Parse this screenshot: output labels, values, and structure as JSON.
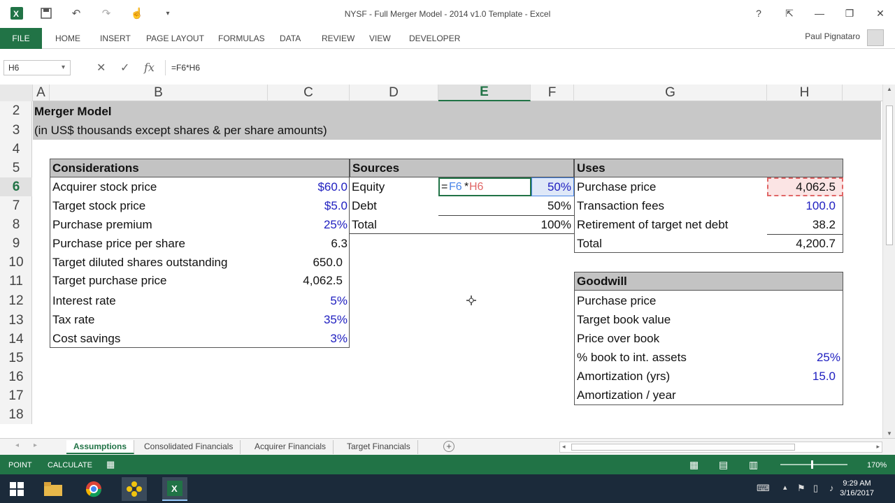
{
  "window": {
    "title": "NYSF - Full Merger Model - 2014 v1.0 Template - Excel",
    "help": "?",
    "restore_ribbon": "⇱",
    "minimize": "—",
    "maximize": "❐",
    "close": "✕"
  },
  "quick_access": {
    "app_icon": "excel-icon",
    "save": "💾",
    "undo": "↶",
    "redo": "↷",
    "touch": "☝",
    "customize": "▾"
  },
  "ribbon": {
    "file": "FILE",
    "tabs": [
      "HOME",
      "INSERT",
      "PAGE LAYOUT",
      "FORMULAS",
      "DATA",
      "REVIEW",
      "VIEW",
      "DEVELOPER"
    ],
    "user": "Paul Pignataro"
  },
  "formula_bar": {
    "name_box": "H6",
    "cancel": "✕",
    "enter": "✓",
    "fx": "fx",
    "formula": "=F6*H6"
  },
  "columns": [
    "A",
    "B",
    "C",
    "D",
    "E",
    "F",
    "G",
    "H"
  ],
  "active_column": "E",
  "rows": [
    "2",
    "3",
    "4",
    "5",
    "6",
    "7",
    "8",
    "9",
    "10",
    "11",
    "12",
    "13",
    "14",
    "15",
    "16",
    "17",
    "18"
  ],
  "active_row": "6",
  "sheet": {
    "title": "Merger Model",
    "subtitle": "(in US$ thousands except shares & per share amounts)",
    "considerations": {
      "header": "Considerations",
      "rows": [
        {
          "label": "Acquirer stock price",
          "value": "$60.0",
          "input": true
        },
        {
          "label": "Target stock price",
          "value": "$5.0",
          "input": true
        },
        {
          "label": "Purchase premium",
          "value": "25%",
          "input": true
        },
        {
          "label": "Purchase price per share",
          "value": "6.3",
          "input": false
        },
        {
          "label": "Target diluted shares outstanding",
          "value": "650.0",
          "input": false
        },
        {
          "label": "Target purchase price",
          "value": "4,062.5",
          "input": false
        },
        {
          "label": "Interest rate",
          "value": "5%",
          "input": true
        },
        {
          "label": "Tax rate",
          "value": "35%",
          "input": true
        },
        {
          "label": "Cost savings",
          "value": "3%",
          "input": true
        }
      ]
    },
    "sources": {
      "header": "Sources",
      "rows": [
        {
          "label": "Equity",
          "formula": "=F6*H6",
          "formula_eq": "=",
          "formula_ref1": "F6",
          "formula_op": "*",
          "formula_ref2": "H6",
          "value": "50%"
        },
        {
          "label": "Debt",
          "value": "50%"
        },
        {
          "label": "Total",
          "value": "100%"
        }
      ]
    },
    "uses": {
      "header": "Uses",
      "rows": [
        {
          "label": "Purchase price",
          "value": "4,062.5"
        },
        {
          "label": "Transaction fees",
          "value": "100.0"
        },
        {
          "label": "Retirement of target net debt",
          "value": "38.2"
        },
        {
          "label": "Total",
          "value": "4,200.7"
        }
      ]
    },
    "goodwill": {
      "header": "Goodwill",
      "rows": [
        {
          "label": "Purchase price",
          "value": ""
        },
        {
          "label": "Target book value",
          "value": ""
        },
        {
          "label": "Price over book",
          "value": ""
        },
        {
          "label": "% book to int. assets",
          "value": "25%"
        },
        {
          "label": "Amortization (yrs)",
          "value": "15.0"
        },
        {
          "label": "Amortization / year",
          "value": ""
        }
      ]
    }
  },
  "sheet_tabs": [
    "Assumptions",
    "Consolidated Financials",
    "Acquirer Financials",
    "Target Financials"
  ],
  "active_tab": "Assumptions",
  "add_sheet": "+",
  "status_bar": {
    "mode": "POINT",
    "calculate": "CALCULATE",
    "zoom": "170%"
  },
  "taskbar": {
    "time": "9:29 AM",
    "date": "3/16/2017"
  }
}
